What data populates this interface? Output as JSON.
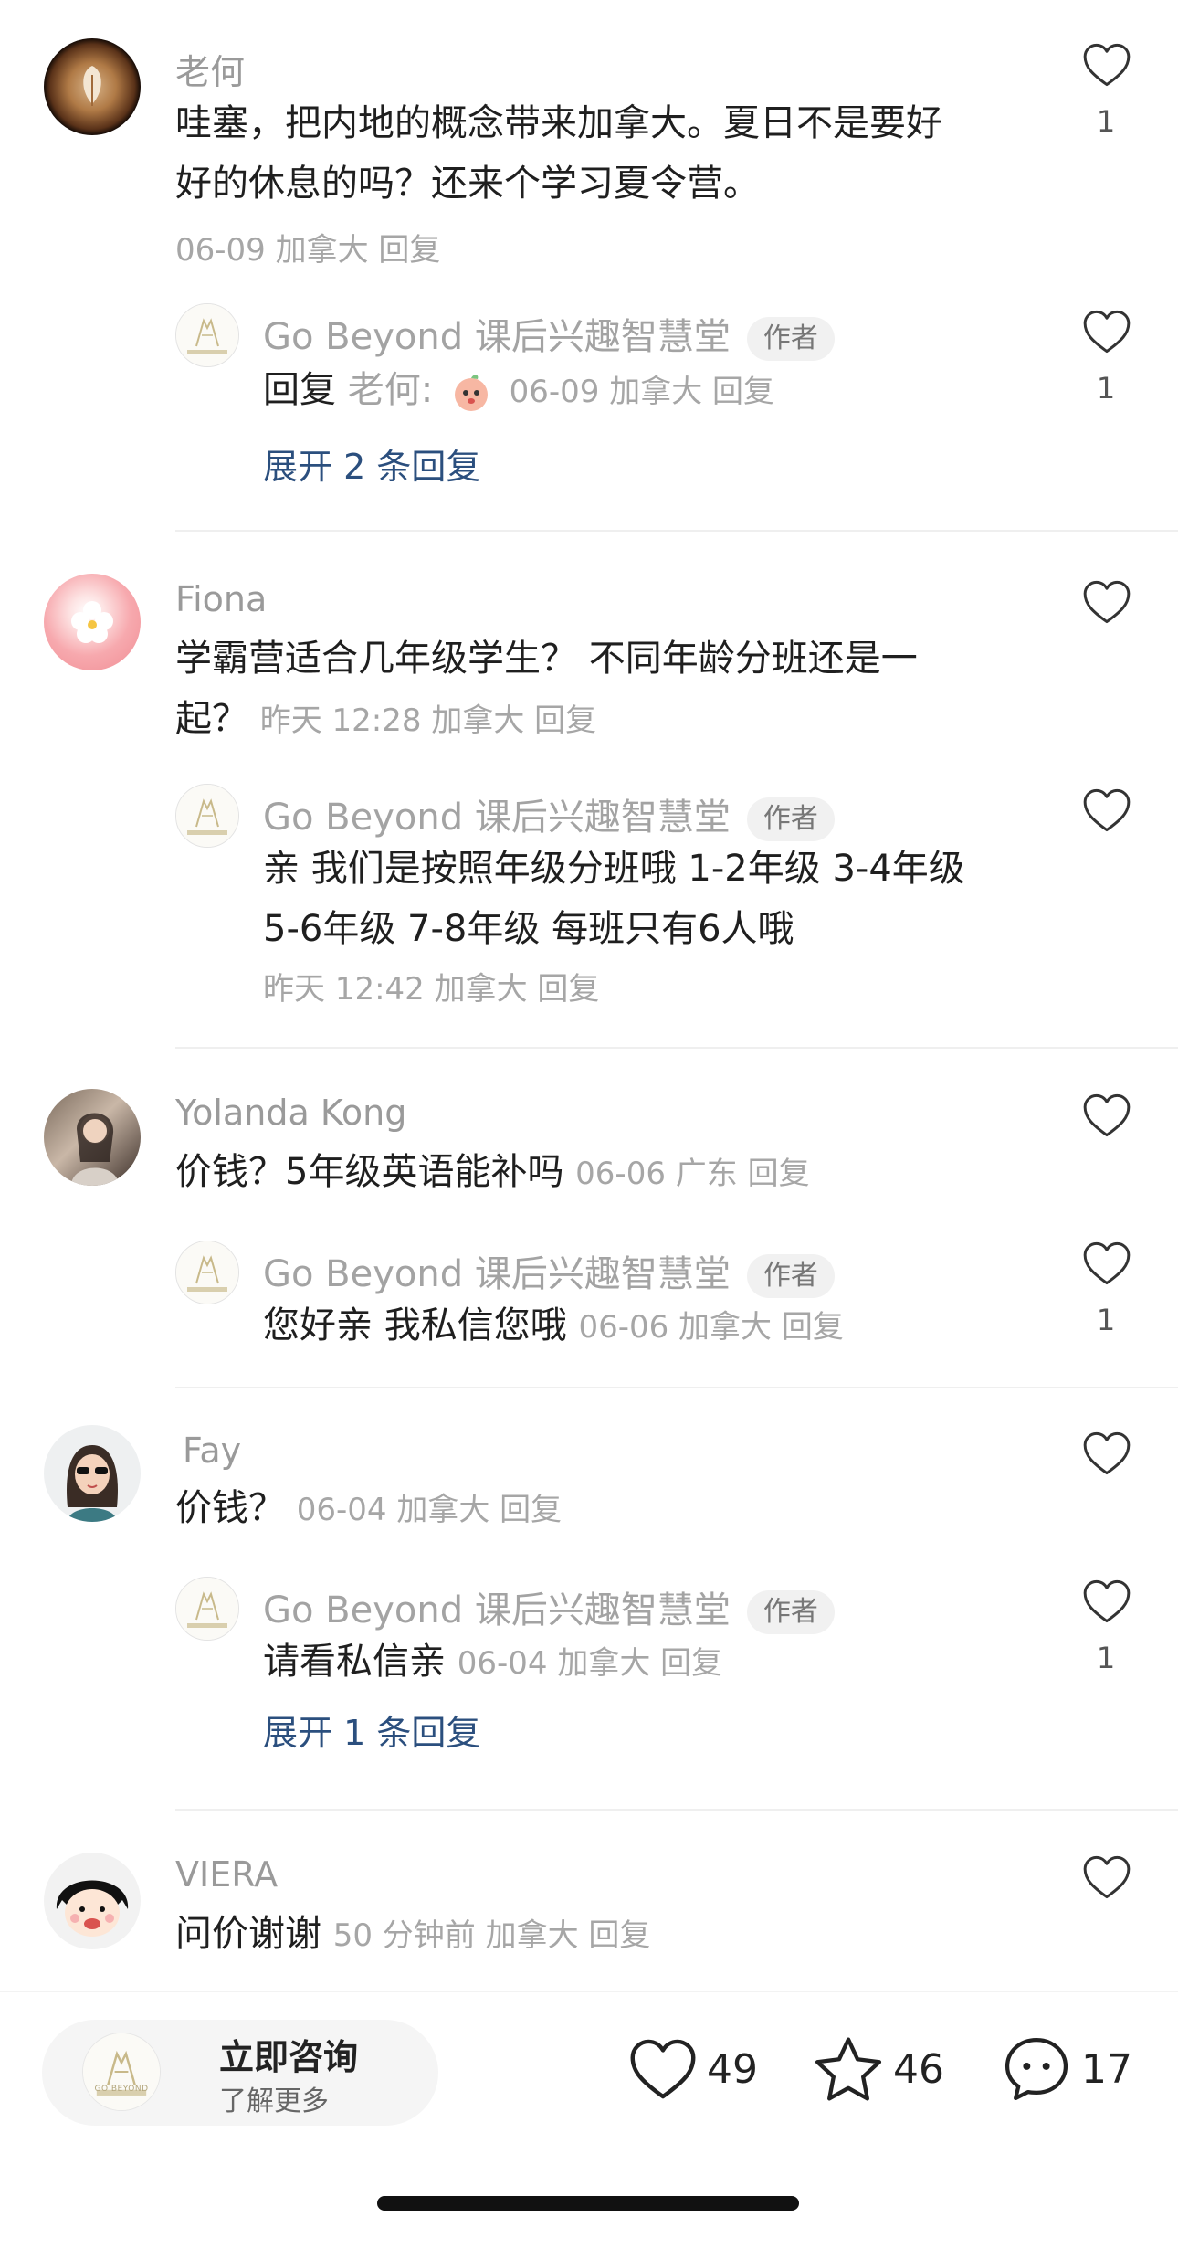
{
  "comments": [
    {
      "user": "老何",
      "text_lines": [
        "哇塞，把内地的概念带来加拿大。夏日不是要好",
        "好的休息的吗？还来个学习夏令营。"
      ],
      "meta": "06-09 加拿大 回复",
      "likes": "1",
      "reply": {
        "user": "Go Beyond 课后兴趣智慧堂",
        "tag": "作者",
        "prefix": "回复",
        "reply_to": "老何:",
        "meta": "06-09 加拿大 回复",
        "likes": "1"
      },
      "expand": "展开 2 条回复"
    },
    {
      "user": "Fiona",
      "text_line1": "学霸营适合几年级学生？ 不同年龄分班还是一",
      "text_line2": "起？",
      "meta": "昨天 12:28 加拿大 回复",
      "reply": {
        "user": "Go Beyond 课后兴趣智慧堂",
        "tag": "作者",
        "text_lines": [
          "亲 我们是按照年级分班哦 1-2年级 3-4年级",
          "5-6年级 7-8年级 每班只有6人哦"
        ],
        "meta": "昨天 12:42 加拿大 回复"
      }
    },
    {
      "user": "Yolanda Kong",
      "text": "价钱？5年级英语能补吗",
      "meta": "06-06 广东 回复",
      "reply": {
        "user": "Go Beyond 课后兴趣智慧堂",
        "tag": "作者",
        "text": "您好亲 我私信您哦",
        "meta": "06-06 加拿大 回复",
        "likes": "1"
      }
    },
    {
      "user": "Fay",
      "text": "价钱？",
      "meta": "06-04 加拿大 回复",
      "reply": {
        "user": "Go Beyond 课后兴趣智慧堂",
        "tag": "作者",
        "text": "请看私信亲",
        "meta": "06-04 加拿大 回复",
        "likes": "1"
      },
      "expand": "展开 1 条回复"
    },
    {
      "user": "VIERA",
      "text": "问价谢谢",
      "meta": "50 分钟前 加拿大 回复"
    }
  ],
  "logo_text": "GO BEYOND",
  "bottom_bar": {
    "cta_title": "立即咨询",
    "cta_subtitle": "了解更多",
    "likes": "49",
    "favorites": "46",
    "comments": "17"
  },
  "colors": {
    "accent_link": "#2b4f7e",
    "muted": "#a6a6a6"
  }
}
